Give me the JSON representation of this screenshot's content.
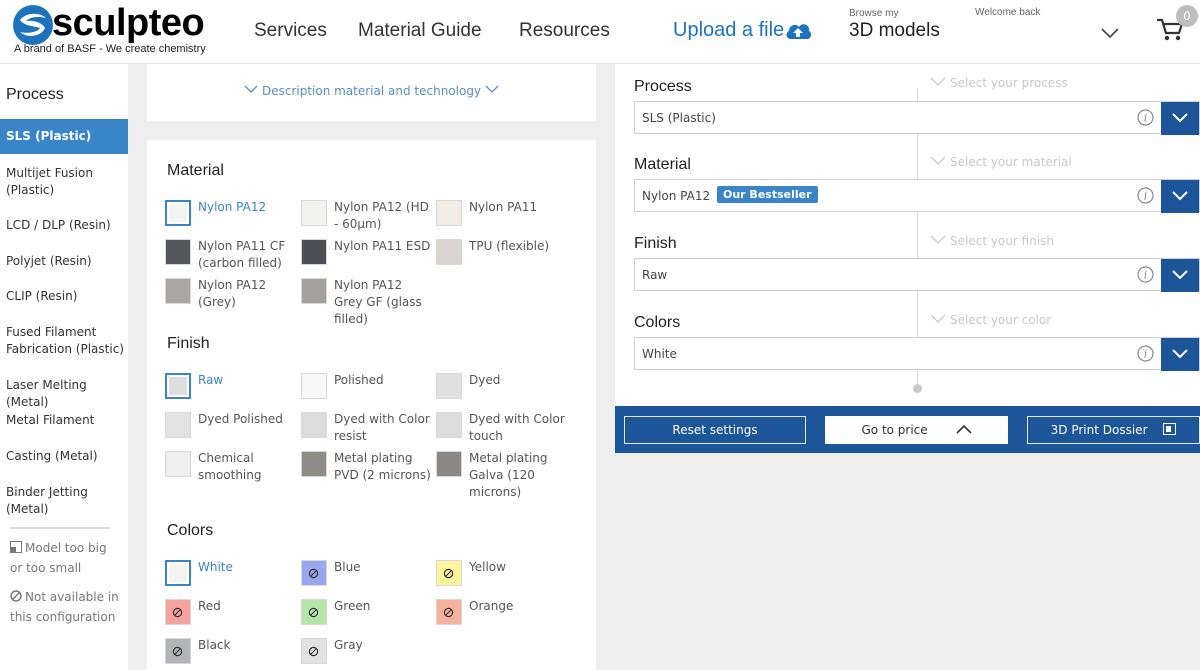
{
  "header": {
    "logo_word": "sculpteo",
    "logo_tagline": "A brand of BASF - We create chemistry",
    "nav": [
      "Services",
      "Material Guide",
      "Resources"
    ],
    "upload_label": "Upload a file",
    "browse_small": "Browse my",
    "models_label": "3D models",
    "welcome": "Welcome back",
    "cart_count": "0"
  },
  "sidebar": {
    "title": "Process",
    "items": [
      {
        "label": "SLS (Plastic)",
        "active": true
      },
      {
        "label": "Multijet Fusion (Plastic)"
      },
      {
        "label": "LCD / DLP (Resin)"
      },
      {
        "label": "Polyjet (Resin)"
      },
      {
        "label": "CLIP (Resin)"
      },
      {
        "label": "Fused Filament Fabrication (Plastic)"
      },
      {
        "label": "Laser Melting (Metal)"
      },
      {
        "label": "Metal Filament"
      },
      {
        "label": "Casting (Metal)"
      },
      {
        "label": "Binder Jetting (Metal)"
      }
    ],
    "legend_too_big": "Model too big or too small",
    "legend_not_available": "Not available in this configuration"
  },
  "description_link": "Description material and technology",
  "options": {
    "material_title": "Material",
    "materials": [
      "Nylon PA12",
      "Nylon PA12 (HD - 60µm)",
      "Nylon PA11",
      "Nylon PA11 CF (carbon filled)",
      "Nylon PA11 ESD",
      "TPU (flexible)",
      "Nylon PA12 (Grey)",
      "Nylon PA12 Grey GF (glass filled)"
    ],
    "finish_title": "Finish",
    "finishes": [
      "Raw",
      "Polished",
      "Dyed",
      "Dyed Polished",
      "Dyed with Color resist",
      "Dyed with Color touch",
      "Chemical smoothing",
      "Metal plating PVD (2 microns)",
      "Metal plating Galva (120 microns)"
    ],
    "colors_title": "Colors",
    "colors": [
      "White",
      "Blue",
      "Yellow",
      "Red",
      "Green",
      "Orange",
      "Black",
      "Gray"
    ]
  },
  "config": {
    "process_label": "Process",
    "process_hint": "Select your process",
    "process_value": "SLS (Plastic)",
    "material_label": "Material",
    "material_hint": "Select your material",
    "material_value": "Nylon PA12",
    "material_badge": "Our Bestseller",
    "finish_label": "Finish",
    "finish_hint": "Select your finish",
    "finish_value": "Raw",
    "colors_label": "Colors",
    "colors_hint": "Select your color",
    "colors_value": "White"
  },
  "actions": {
    "reset": "Reset settings",
    "price": "Go to price",
    "dossier": "3D Print Dossier"
  },
  "colors": {
    "accent": "#3a85c8",
    "dark_blue": "#1d5599",
    "link_blue": "#1e73be"
  }
}
